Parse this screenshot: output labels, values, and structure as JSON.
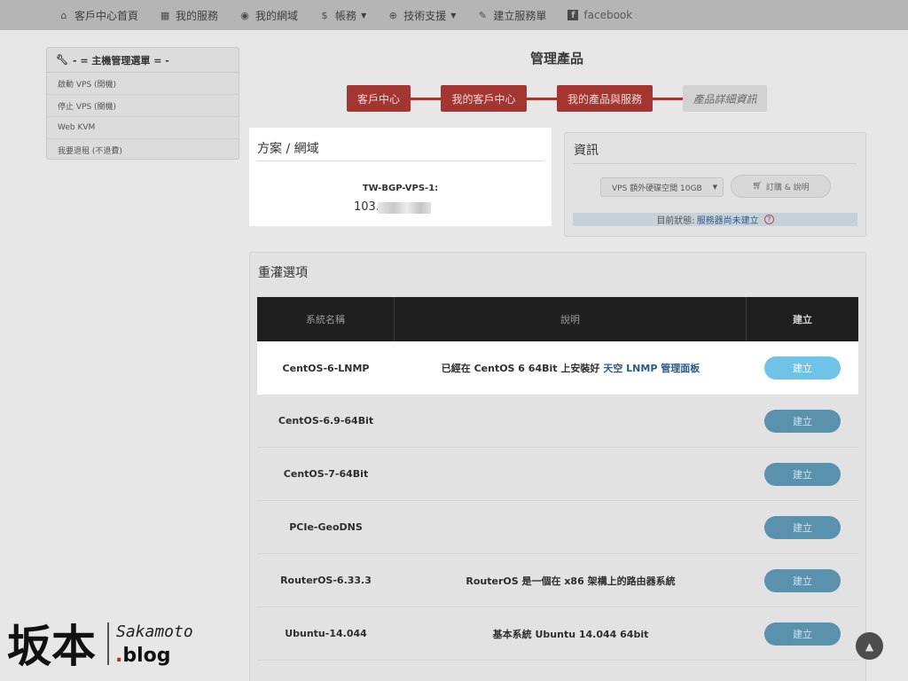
{
  "nav": {
    "items": [
      {
        "label": "客戶中心首頁",
        "icon": "home-icon"
      },
      {
        "label": "我的服務",
        "icon": "list-icon"
      },
      {
        "label": "我的網域",
        "icon": "globe-icon"
      },
      {
        "label": "帳務",
        "icon": "dollar-icon"
      },
      {
        "label": "技術支援",
        "icon": "lifebuoy-icon"
      },
      {
        "label": "建立服務單",
        "icon": "edit-icon"
      },
      {
        "label": "facebook",
        "icon": "facebook-icon"
      }
    ]
  },
  "sidebar": {
    "title": "- = 主機管理選單 = -",
    "items": [
      {
        "label": "啟動 VPS (開機)"
      },
      {
        "label": "停止 VPS (關機)"
      },
      {
        "label": "Web KVM"
      },
      {
        "label": "我要退租 (不退費)"
      }
    ]
  },
  "page": {
    "title": "管理產品",
    "breadcrumb": [
      "客戶中心",
      "我的客戶中心",
      "我的產品與服務",
      "產品詳細資訊"
    ]
  },
  "plan": {
    "title": "方案 / 網域",
    "name": "TW-BGP-VPS-1:",
    "ip_visible": "103."
  },
  "info": {
    "title": "資訊",
    "addon_select": "VPS 額外硬碟空間 10GB",
    "order_button": "訂購 & 說明",
    "status_label": "目前狀態:",
    "status_value": "服務器尚未建立",
    "help": "?"
  },
  "reinstall": {
    "title": "重灌選項",
    "columns": [
      "系統名稱",
      "說明",
      "建立"
    ],
    "rows": [
      {
        "name": "CentOS-6-LNMP",
        "desc": "已經在 CentOS 6 64Bit 上安裝好",
        "desc_link": "天空 LNMP 管理面板",
        "button": "建立"
      },
      {
        "name": "CentOS-6.9-64Bit",
        "desc": "",
        "desc_link": "",
        "button": "建立"
      },
      {
        "name": "CentOS-7-64Bit",
        "desc": "",
        "desc_link": "",
        "button": "建立"
      },
      {
        "name": "PCIe-GeoDNS",
        "desc": "",
        "desc_link": "",
        "button": "建立"
      },
      {
        "name": "RouterOS-6.33.3",
        "desc": "RouterOS 是一個在 x86 架構上的路由器系統",
        "desc_link": "",
        "button": "建立"
      },
      {
        "name": "Ubuntu-14.044",
        "desc": "基本系統 Ubuntu 14.044 64bit",
        "desc_link": "",
        "button": "建立"
      }
    ]
  },
  "logo": {
    "cn": "坂本",
    "en": "Sakamoto",
    "sub": ".blog"
  },
  "colors": {
    "crumb_red": "#a33630",
    "button_blue": "#6ec3e6",
    "link_blue": "#2a5b88"
  }
}
